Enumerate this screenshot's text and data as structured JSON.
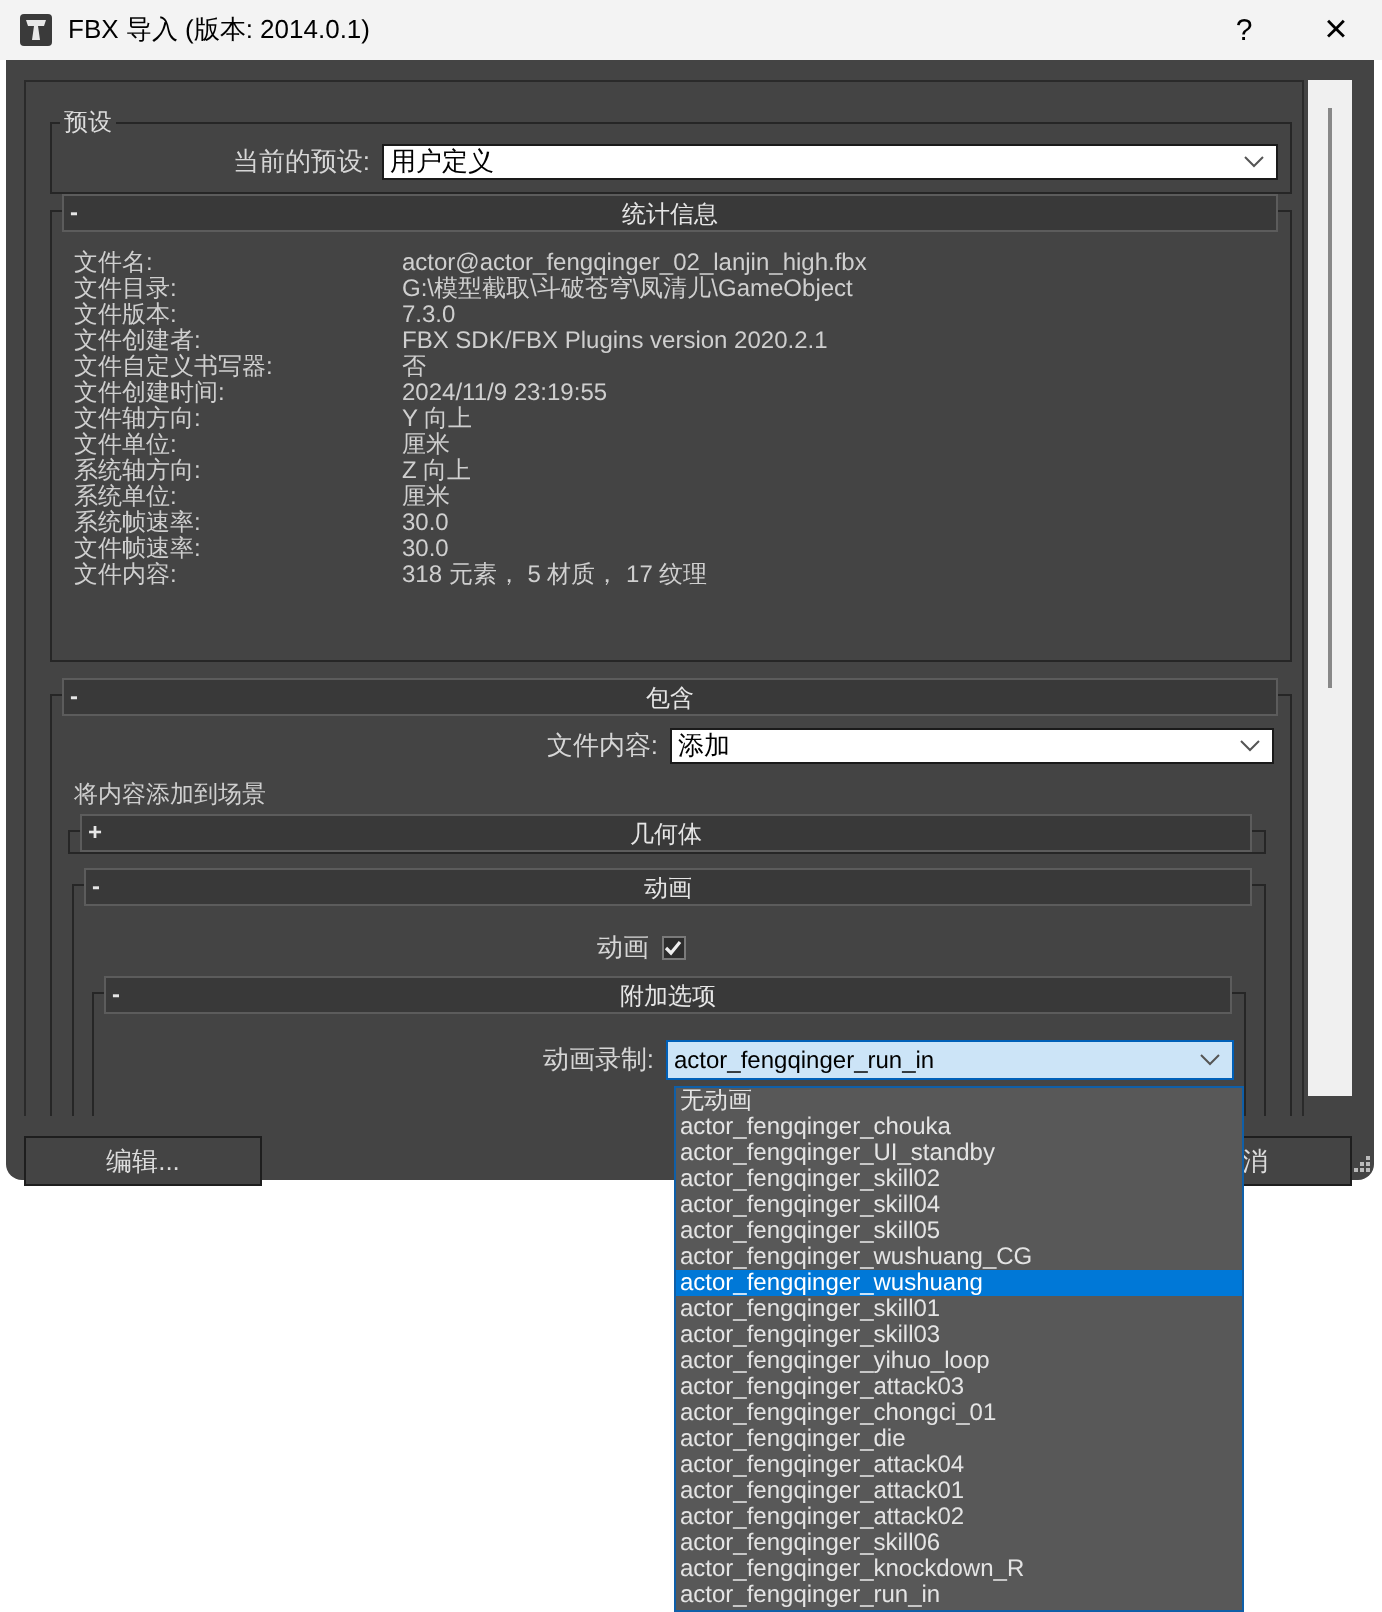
{
  "window": {
    "title": "FBX 导入 (版本: 2014.0.1)",
    "help_button": "?",
    "close_button": "×"
  },
  "presets": {
    "group_label": "预设",
    "current_label": "当前的预设:",
    "current_value": "用户定义"
  },
  "statistics": {
    "title": "统计信息",
    "toggle": "-",
    "rows": [
      {
        "label": "文件名:",
        "value": "actor@actor_fengqinger_02_lanjin_high.fbx"
      },
      {
        "label": "文件目录:",
        "value": "G:\\模型截取\\斗破苍穹\\凤清儿\\GameObject"
      },
      {
        "label": "文件版本:",
        "value": "7.3.0"
      },
      {
        "label": "文件创建者:",
        "value": "FBX SDK/FBX Plugins version 2020.2.1"
      },
      {
        "label": "文件自定义书写器:",
        "value": "否"
      },
      {
        "label": "文件创建时间:",
        "value": "2024/11/9  23:19:55"
      },
      {
        "label": "文件轴方向:",
        "value": "Y 向上"
      },
      {
        "label": "文件单位:",
        "value": "厘米"
      },
      {
        "label": "系统轴方向:",
        "value": "Z 向上"
      },
      {
        "label": "系统单位:",
        "value": "厘米"
      },
      {
        "label": "系统帧速率:",
        "value": "30.0"
      },
      {
        "label": "文件帧速率:",
        "value": "30.0"
      },
      {
        "label": "文件内容:",
        "value": "318 元素， 5 材质， 17 纹理"
      }
    ]
  },
  "include": {
    "title": "包含",
    "toggle": "-",
    "file_content_label": "文件内容:",
    "file_content_value": "添加",
    "description": "将内容添加到场景",
    "geometry": {
      "title": "几何体",
      "toggle": "+"
    },
    "animation": {
      "title": "动画",
      "toggle": "-",
      "checkbox_label": "动画",
      "checked": true,
      "extra_options": {
        "title": "附加选项",
        "toggle": "-",
        "take_label": "动画录制:",
        "take_value": "actor_fengqinger_run_in",
        "options": [
          {
            "label": "无动画",
            "selected": false
          },
          {
            "label": "actor_fengqinger_chouka",
            "selected": false
          },
          {
            "label": "actor_fengqinger_UI_standby",
            "selected": false
          },
          {
            "label": "actor_fengqinger_skill02",
            "selected": false
          },
          {
            "label": "actor_fengqinger_skill04",
            "selected": false
          },
          {
            "label": "actor_fengqinger_skill05",
            "selected": false
          },
          {
            "label": "actor_fengqinger_wushuang_CG",
            "selected": false
          },
          {
            "label": "actor_fengqinger_wushuang",
            "selected": true
          },
          {
            "label": "actor_fengqinger_skill01",
            "selected": false
          },
          {
            "label": "actor_fengqinger_skill03",
            "selected": false
          },
          {
            "label": "actor_fengqinger_yihuo_loop",
            "selected": false
          },
          {
            "label": "actor_fengqinger_attack03",
            "selected": false
          },
          {
            "label": "actor_fengqinger_chongci_01",
            "selected": false
          },
          {
            "label": "actor_fengqinger_die",
            "selected": false
          },
          {
            "label": "actor_fengqinger_attack04",
            "selected": false
          },
          {
            "label": "actor_fengqinger_attack01",
            "selected": false
          },
          {
            "label": "actor_fengqinger_attack02",
            "selected": false
          },
          {
            "label": "actor_fengqinger_skill06",
            "selected": false
          },
          {
            "label": "actor_fengqinger_knockdown_R",
            "selected": false
          },
          {
            "label": "actor_fengqinger_run_in",
            "selected": false
          }
        ]
      }
    }
  },
  "buttons": [
    {
      "kind": "edit",
      "label": "编辑..."
    },
    {
      "kind": "cancel",
      "label": "消"
    }
  ]
}
